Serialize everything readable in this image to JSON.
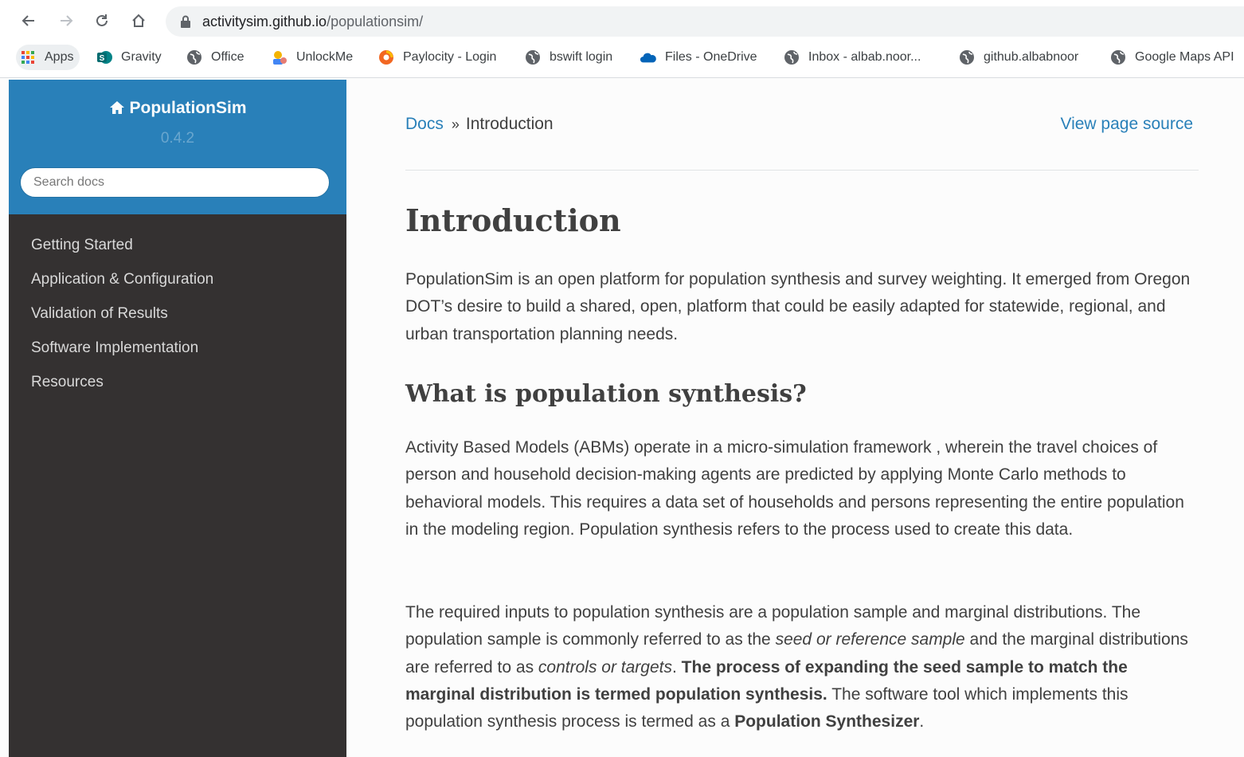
{
  "browser": {
    "url_domain": "activitysim.github.io",
    "url_path": "/populationsim/",
    "bookmarks": [
      {
        "label": "Apps",
        "icon": "apps-grid-icon"
      },
      {
        "label": "Gravity",
        "icon": "sharepoint-icon"
      },
      {
        "label": "Office",
        "icon": "globe-icon"
      },
      {
        "label": "UnlockMe",
        "icon": "unlockme-icon"
      },
      {
        "label": "Paylocity - Login",
        "icon": "paylocity-icon"
      },
      {
        "label": "bswift login",
        "icon": "globe-icon"
      },
      {
        "label": "Files - OneDrive",
        "icon": "onedrive-cloud-icon"
      },
      {
        "label": "Inbox - albab.noor...",
        "icon": "globe-icon"
      },
      {
        "label": "github.albabnoor",
        "icon": "globe-icon"
      },
      {
        "label": "Google Maps API",
        "icon": "globe-icon"
      }
    ]
  },
  "sidebar": {
    "project": "PopulationSim",
    "version": "0.4.2",
    "search_placeholder": "Search docs",
    "items": [
      {
        "label": "Getting Started"
      },
      {
        "label": "Application & Configuration"
      },
      {
        "label": "Validation of Results"
      },
      {
        "label": "Software Implementation"
      },
      {
        "label": "Resources"
      }
    ]
  },
  "breadcrumb": {
    "root": "Docs",
    "separator": "»",
    "current": "Introduction",
    "view_source": "View page source"
  },
  "page": {
    "title": "Introduction",
    "intro": "PopulationSim is an open platform for population synthesis and survey weighting. It emerged from Oregon DOT’s desire to build a shared, open, platform that could be easily adapted for statewide, regional, and urban transportation planning needs.",
    "section_title": "What is population synthesis?",
    "section_p1": "Activity Based Models (ABMs) operate in a micro-simulation framework , wherein the travel choices of person and household decision-making agents are predicted by applying Monte Carlo methods to behavioral models. This requires a data set of households and persons representing the entire population in the modeling region. Population synthesis refers to the process used to create this data.",
    "section_p2": {
      "t1": "The required inputs to population synthesis are a population sample and marginal distributions. The population sample is commonly referred to as the ",
      "em1": "seed or reference sample",
      "t2": " and the marginal distributions are referred to as ",
      "em2": "controls or targets",
      "t3": ". ",
      "strong1": "The process of expanding the seed sample to match the marginal distribution is termed population synthesis.",
      "t4": " The software tool which implements this population synthesis process is termed as a ",
      "strong2": "Population Synthesizer",
      "t5": "."
    }
  },
  "colors": {
    "sidebar_bg": "#343131",
    "sidebar_header_bg": "#2980b9",
    "link": "#2980b9",
    "text": "#404040"
  }
}
